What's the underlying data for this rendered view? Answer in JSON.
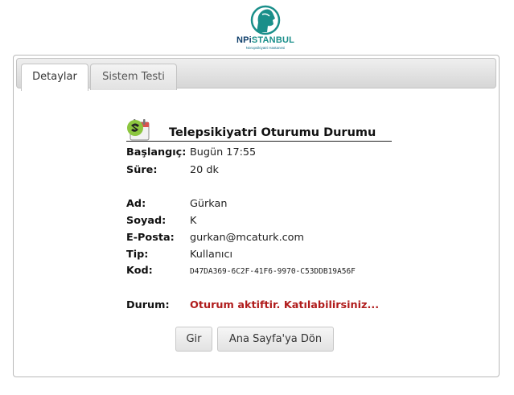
{
  "logo": {
    "name_prefix": "NPi",
    "name_suffix": "STANBUL",
    "subtitle": "Nöropsikiyatri Hastanesi"
  },
  "tabs": [
    {
      "label": "Detaylar",
      "active": true
    },
    {
      "label": "Sistem Testi",
      "active": false
    }
  ],
  "session": {
    "title": "Telepsikiyatri Oturumu Durumu",
    "fields": {
      "start": {
        "label": "Başlangıç:",
        "value": "Bugün 17:55"
      },
      "duration": {
        "label": "Süre:",
        "value": "20 dk"
      },
      "first_name": {
        "label": "Ad:",
        "value": "Gürkan"
      },
      "last_name": {
        "label": "Soyad:",
        "value": "K"
      },
      "email": {
        "label": "E-Posta:",
        "value": "gurkan@mcaturk.com"
      },
      "type": {
        "label": "Tip:",
        "value": "Kullanıcı"
      },
      "code": {
        "label": "Kod:",
        "value": "D47DA369-6C2F-41F6-9970-C53DDB19A56F"
      },
      "status": {
        "label": "Durum:",
        "value": "Oturum aktiftir. Katılabilirsiniz..."
      }
    }
  },
  "buttons": {
    "join": "Gir",
    "home": "Ana Sayfa'ya Dön"
  },
  "colors": {
    "status_text": "#b01c1c",
    "logo_teal": "#1a8f8a",
    "logo_navy": "#0f3f6b"
  }
}
